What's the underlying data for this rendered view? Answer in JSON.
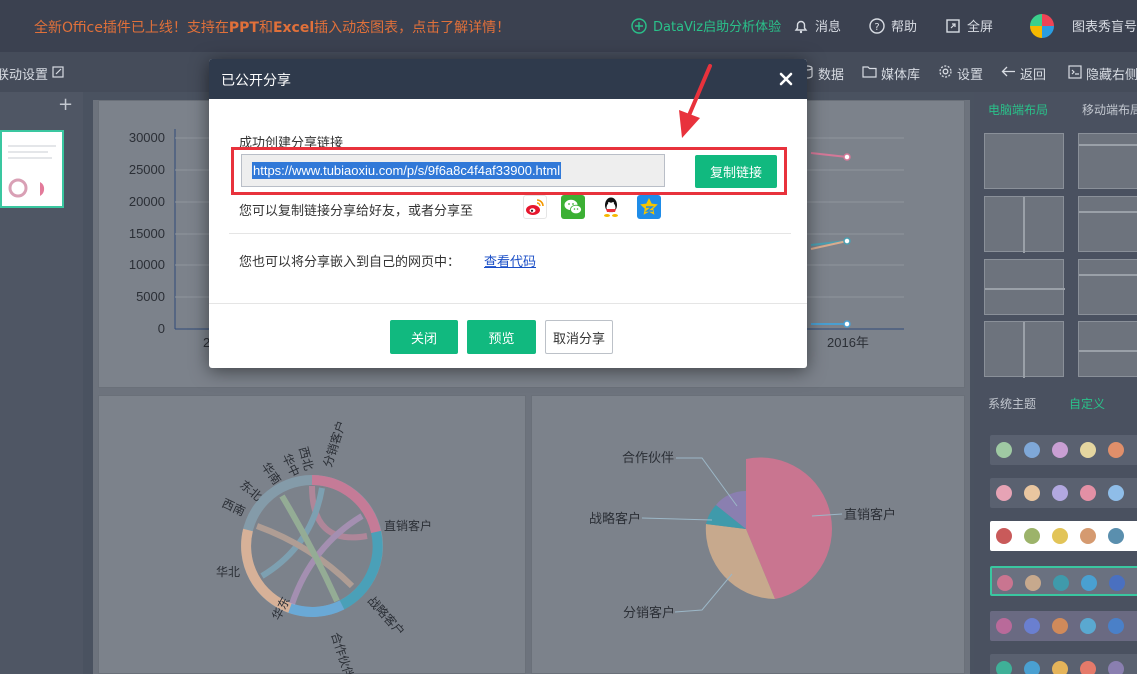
{
  "topbar": {
    "announce_pre": "全新Office插件已上线！支持在",
    "announce_b1": "PPT",
    "announce_mid": "和",
    "announce_b2": "Excel",
    "announce_post": "插入动态图表，点击了解详情！",
    "datavis": "DataViz启助分析体验",
    "messages": "消息",
    "help": "帮助",
    "fullscreen": "全屏",
    "user": "图表秀盲号"
  },
  "toolbar": {
    "anim": "联动设置",
    "data": "数据",
    "media": "媒体库",
    "settings": "设置",
    "back": "返回",
    "hide_right": "隐藏右侧"
  },
  "right_panel": {
    "tab_pc": "电脑端布局",
    "tab_mobile": "移动端布局",
    "tab_system": "系统主题",
    "tab_custom": "自定义"
  },
  "line_chart": {
    "yticks": [
      "30000",
      "25000",
      "20000",
      "15000",
      "10000",
      "5000",
      "0"
    ],
    "xlabel_last": "2016年",
    "xlabel_first": "2"
  },
  "chord_chart": {
    "labels": [
      "分销客户",
      "直销客户",
      "战略客户",
      "合作伙伴",
      "华东",
      "华北",
      "西南",
      "东北",
      "华南",
      "华中",
      "西北"
    ]
  },
  "pie_chart": {
    "labels": [
      "合作伙伴",
      "直销客户",
      "战略客户",
      "分销客户"
    ]
  },
  "dialog": {
    "title": "已公开分享",
    "success_label": "成功创建分享链接",
    "url": "https://www.tubiaoxiu.com/p/s/9f6a8c4f4af33900.html",
    "copy_label": "复制链接",
    "share_text": "您可以复制链接分享给好友，或者分享至",
    "share_icons": [
      "weibo-icon",
      "wechat-icon",
      "qq-icon",
      "qzone-icon"
    ],
    "embed_text": "您也可以将分享嵌入到自己的网页中：",
    "view_code": "查看代码",
    "btn_close": "关闭",
    "btn_preview": "预览",
    "btn_cancel": "取消分享"
  },
  "colors": {
    "accent": "#11b97f",
    "highlight": "#e8323c",
    "dialog_header": "#2f3a4c"
  }
}
